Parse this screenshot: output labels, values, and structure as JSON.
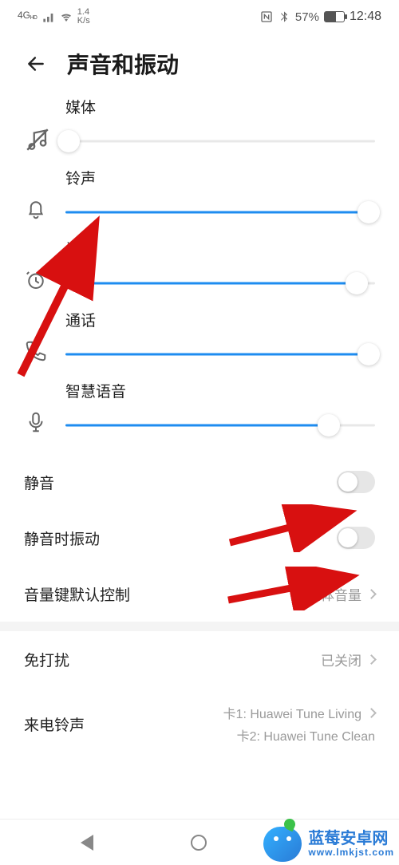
{
  "status": {
    "network": "4G",
    "net_sub": "ᴴᴰ",
    "speed_top": "1.4",
    "speed_bottom": "K/s",
    "nfc_label": "NFC",
    "battery_pct": "57%",
    "clock": "12:48"
  },
  "header": {
    "title": "声音和振动"
  },
  "sliders": {
    "items": [
      {
        "label": "媒体",
        "icon": "music-mute",
        "value": 1
      },
      {
        "label": "铃声",
        "icon": "bell",
        "value": 98
      },
      {
        "label": "闹钟",
        "icon": "clock",
        "value": 94
      },
      {
        "label": "通话",
        "icon": "phone",
        "value": 98
      },
      {
        "label": "智慧语音",
        "icon": "mic",
        "value": 85
      }
    ]
  },
  "toggles": {
    "silent": {
      "label": "静音",
      "on": false
    },
    "vibrate": {
      "label": "静音时振动",
      "on": false
    }
  },
  "rows": {
    "volume_key": {
      "label": "音量键默认控制",
      "value": "媒体音量"
    },
    "do_not_disturb": {
      "label": "免打扰",
      "value": "已关闭"
    },
    "ringtone": {
      "label": "来电铃声",
      "lines": [
        "卡1: Huawei Tune Living",
        "卡2: Huawei Tune Clean"
      ]
    }
  },
  "logo": {
    "name": "蓝莓安卓网",
    "url": "www.lmkjst.com"
  }
}
